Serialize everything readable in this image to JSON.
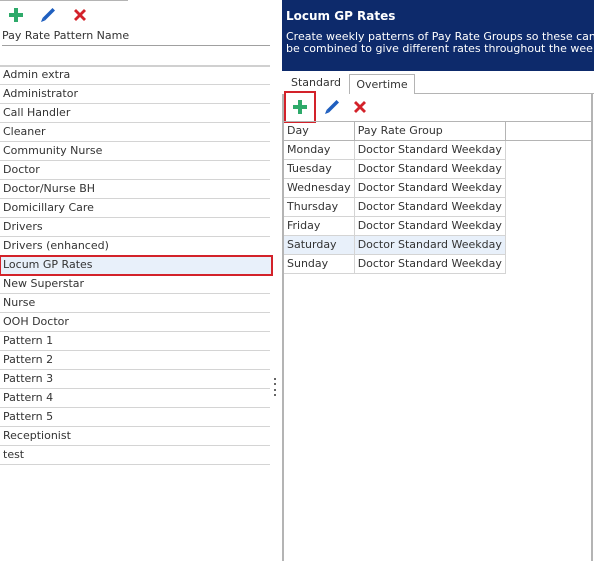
{
  "left_panel": {
    "toolbar": {
      "add_icon": "plus-icon",
      "edit_icon": "pencil-icon",
      "delete_icon": "x-icon"
    },
    "column_header": "Pay Rate Pattern Name",
    "filter_value": "",
    "items": [
      {
        "label": "Admin extra"
      },
      {
        "label": "Administrator"
      },
      {
        "label": "Call Handler"
      },
      {
        "label": "Cleaner"
      },
      {
        "label": "Community Nurse"
      },
      {
        "label": "Doctor"
      },
      {
        "label": "Doctor/Nurse BH"
      },
      {
        "label": "Domicillary Care"
      },
      {
        "label": "Drivers"
      },
      {
        "label": "Drivers (enhanced)"
      },
      {
        "label": "Locum GP Rates",
        "selected": true
      },
      {
        "label": "New Superstar"
      },
      {
        "label": "Nurse"
      },
      {
        "label": "OOH Doctor"
      },
      {
        "label": "Pattern 1"
      },
      {
        "label": "Pattern 2"
      },
      {
        "label": "Pattern 3"
      },
      {
        "label": "Pattern 4"
      },
      {
        "label": "Pattern 5"
      },
      {
        "label": "Receptionist"
      },
      {
        "label": "test"
      }
    ]
  },
  "right_panel": {
    "banner": {
      "title": "Locum GP Rates",
      "description": "Create weekly patterns of Pay Rate Groups so these can be combined to give different rates throughout the week."
    },
    "tabs": [
      {
        "label": "Standard",
        "active": true
      },
      {
        "label": "Overtime",
        "active": false
      }
    ],
    "grid": {
      "columns": [
        "Day",
        "Pay Rate Group"
      ],
      "rows": [
        {
          "day": "Monday",
          "group": "Doctor Standard Weekday"
        },
        {
          "day": "Tuesday",
          "group": "Doctor Standard Weekday"
        },
        {
          "day": "Wednesday",
          "group": "Doctor Standard Weekday"
        },
        {
          "day": "Thursday",
          "group": "Doctor Standard Weekday"
        },
        {
          "day": "Friday",
          "group": "Doctor Standard Weekday"
        },
        {
          "day": "Saturday",
          "group": "Doctor Standard Weekday",
          "selected": true
        },
        {
          "day": "Sunday",
          "group": "Doctor Standard Weekday"
        }
      ]
    }
  },
  "colors": {
    "banner_bg": "#0d2a6b",
    "add_green": "#2eaa6a",
    "edit_blue": "#1f5fbf",
    "delete_red": "#d3222a",
    "highlight_red": "#d3222a",
    "selection_bg": "#e8f0fa"
  }
}
